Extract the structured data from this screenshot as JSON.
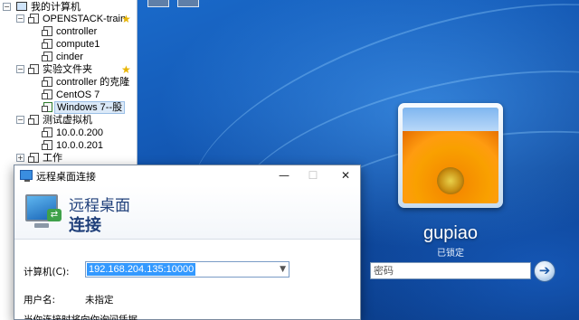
{
  "tree": {
    "root": "我的计算机",
    "groups": [
      {
        "name": "OPENSTACK-train",
        "favorite": true,
        "children": [
          "controller",
          "compute1",
          "cinder"
        ]
      },
      {
        "name": "实验文件夹",
        "favorite": true,
        "children": [
          "controller 的克隆",
          "CentOS 7",
          "Windows 7--股"
        ]
      },
      {
        "name": "测试虚拟机",
        "favorite": false,
        "children": [
          "10.0.0.200",
          "10.0.0.201"
        ]
      },
      {
        "name": "工作",
        "favorite": false,
        "children": []
      }
    ],
    "selected": "Windows 7--股"
  },
  "lock_screen": {
    "username": "gupiao",
    "status": "已锁定",
    "password_placeholder": "密码",
    "go_glyph": "➔"
  },
  "rdp_dialog": {
    "title": "远程桌面连接",
    "banner_line1": "远程桌面",
    "banner_line2": "连接",
    "computer_label": "计算机(C):",
    "computer_value": "192.168.204.135:10000",
    "user_label": "用户名:",
    "user_value": "未指定",
    "hint": "当你连接时将向你询问凭据。",
    "controls": {
      "minimize": "—",
      "maximize": "☐",
      "close": "✕"
    }
  },
  "colors": {
    "desktop": "#145bb8",
    "selection": "#3399ff",
    "banner_text": "#1f3f7a"
  }
}
